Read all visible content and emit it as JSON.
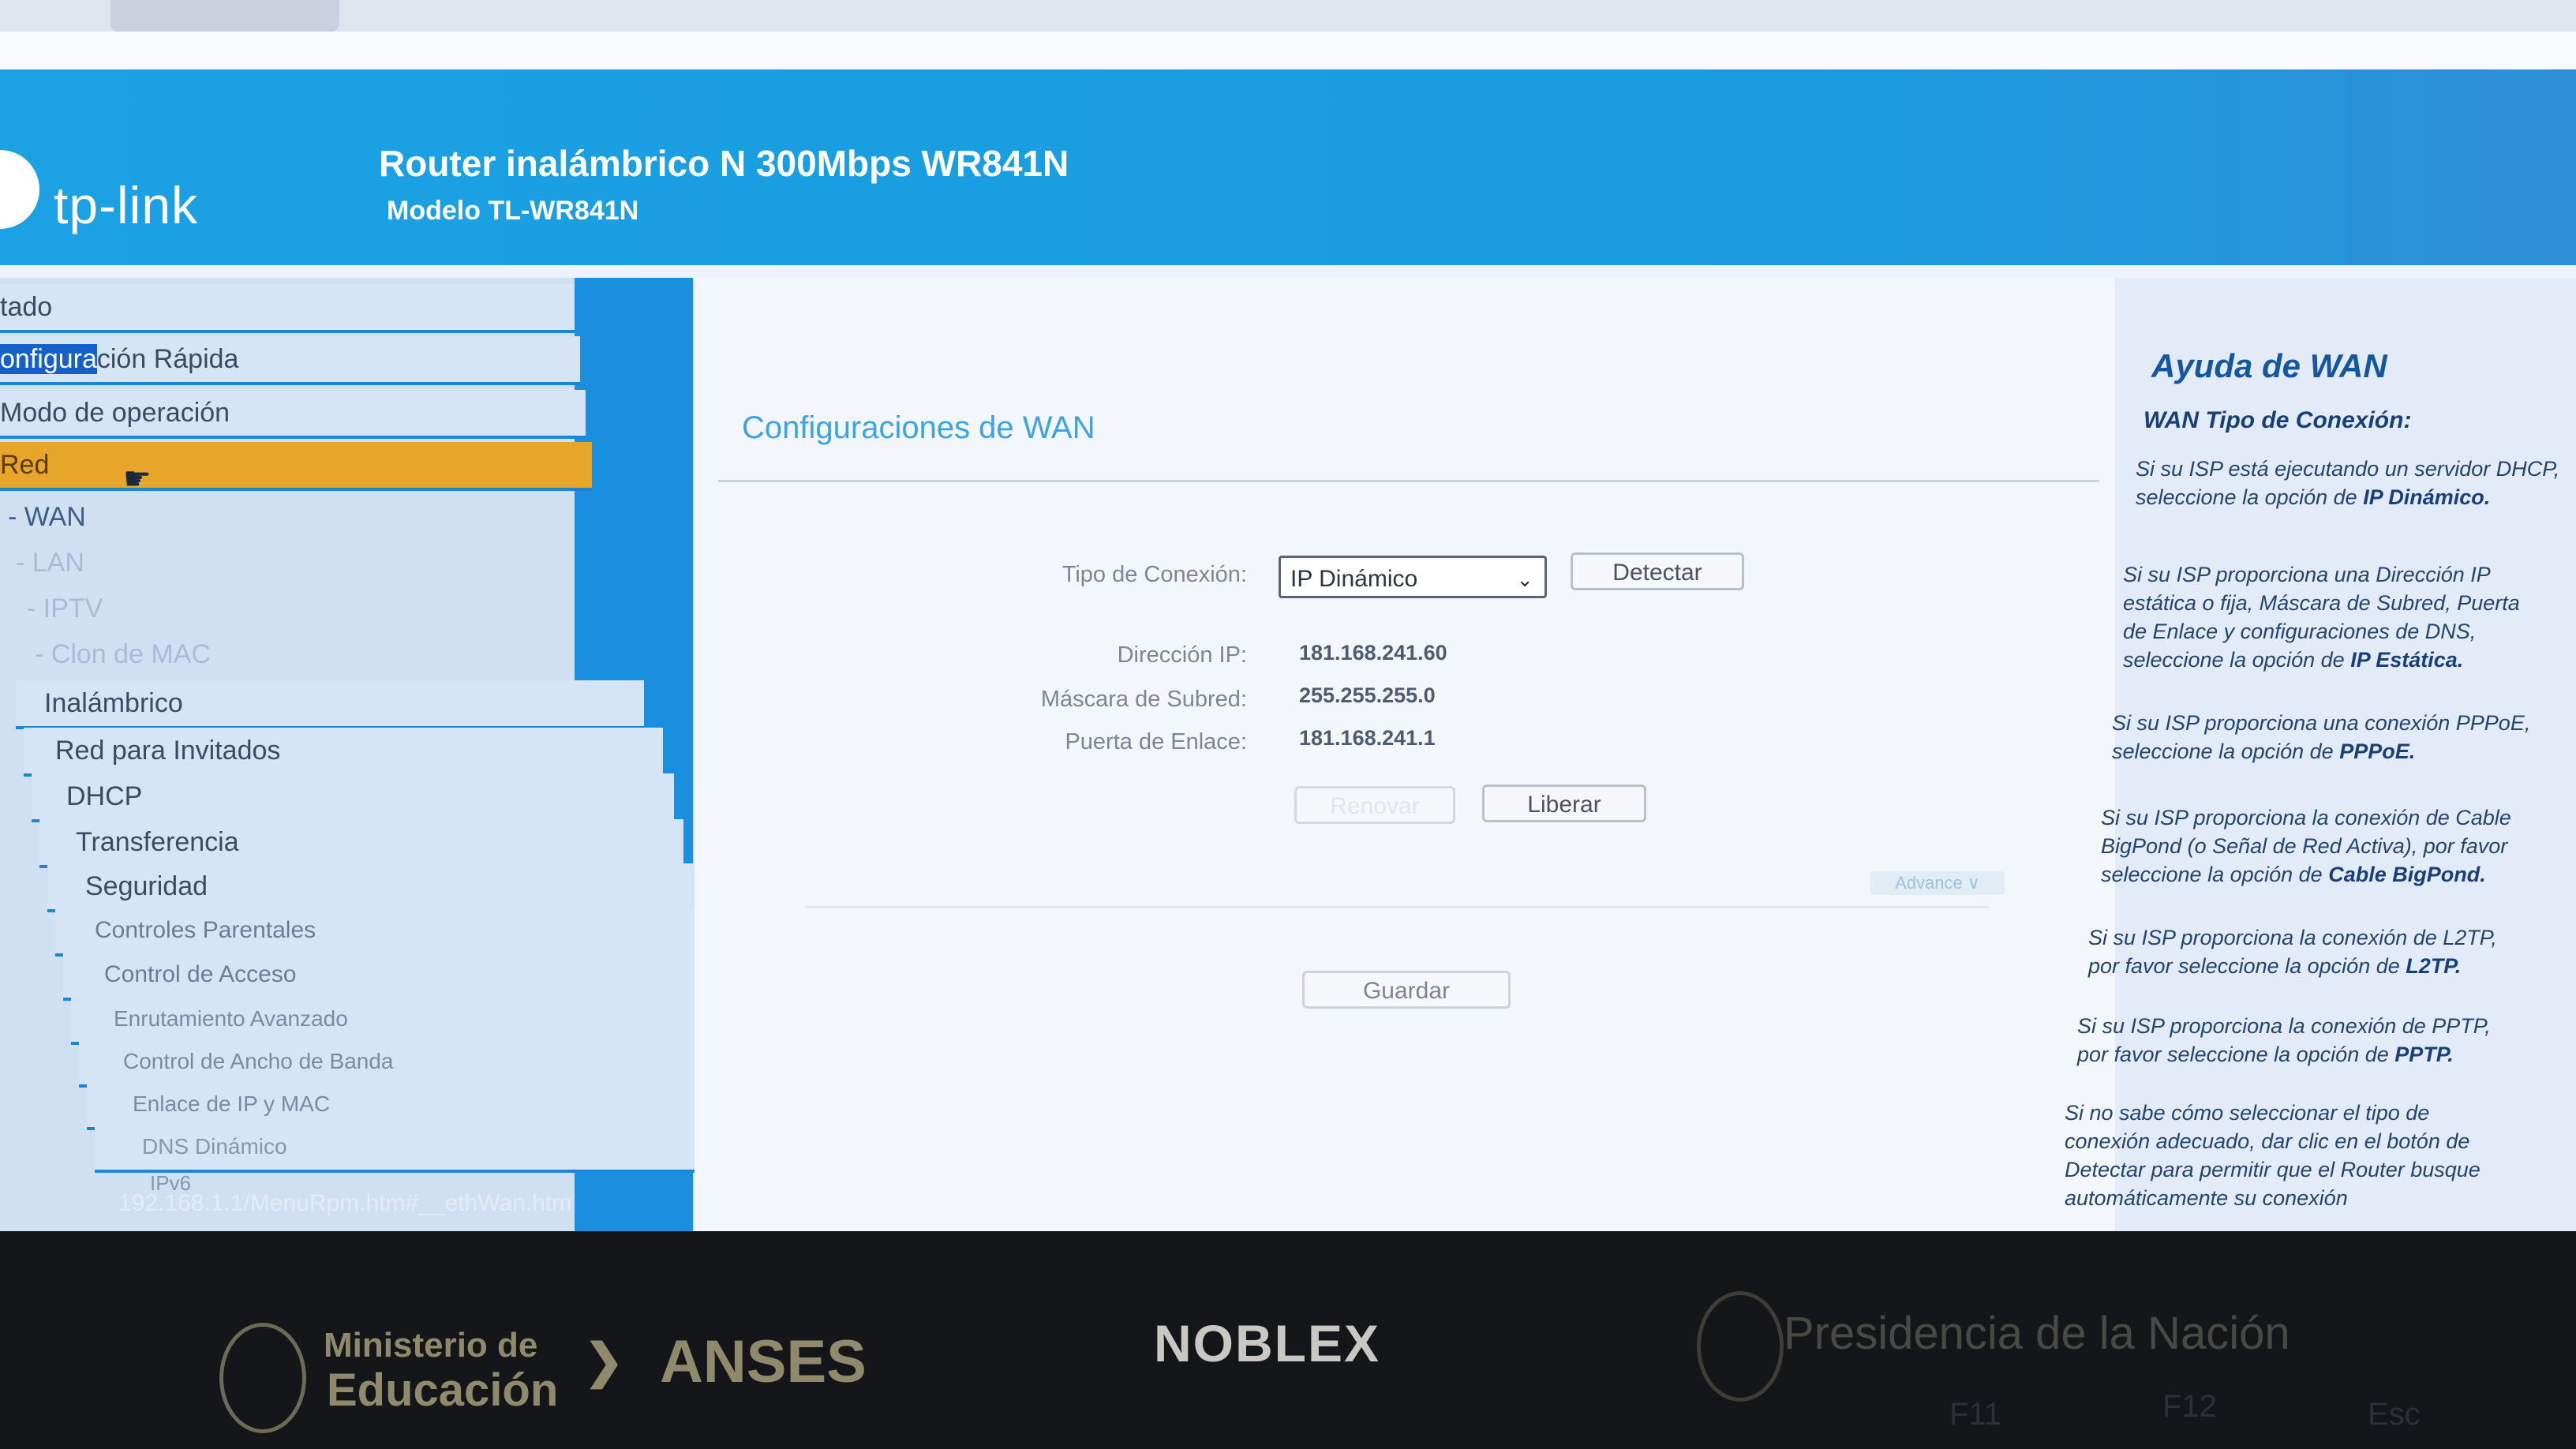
{
  "header": {
    "logo": "tp-link",
    "title": "Router inalámbrico N 300Mbps WR841N",
    "model": "Modelo TL-WR841N"
  },
  "sidebar": {
    "items": [
      {
        "label": "tado"
      },
      {
        "label_highlight": "onfigura",
        "label_rest": "ción Rápida"
      },
      {
        "label": "Modo de operación"
      },
      {
        "label": "Red"
      },
      {
        "label": "- WAN"
      },
      {
        "label": "- LAN"
      },
      {
        "label": "- IPTV"
      },
      {
        "label": "- Clon de MAC"
      },
      {
        "label": "Inalámbrico"
      },
      {
        "label": "Red para Invitados"
      },
      {
        "label": "DHCP"
      },
      {
        "label": "Transferencia"
      },
      {
        "label": "Seguridad"
      },
      {
        "label": "Controles Parentales"
      },
      {
        "label": "Control de Acceso"
      },
      {
        "label": "Enrutamiento Avanzado"
      },
      {
        "label": "Control de Ancho de Banda"
      },
      {
        "label": "Enlace de IP y MAC"
      },
      {
        "label": "DNS Dinámico"
      },
      {
        "label": "IPv6"
      }
    ]
  },
  "status_url": "192.168.1.1/MenuRpm.htm#__ethWan.htm",
  "main": {
    "section_title": "Configuraciones de WAN",
    "connection_type_label": "Tipo de Conexión:",
    "connection_type_value": "IP Dinámico",
    "detect_button": "Detectar",
    "ip_label": "Dirección IP:",
    "ip_value": "181.168.241.60",
    "mask_label": "Máscara de Subred:",
    "mask_value": "255.255.255.0",
    "gateway_label": "Puerta de Enlace:",
    "gateway_value": "181.168.241.1",
    "renew_button": "Renovar",
    "release_button": "Liberar",
    "advance_button": "Advance ∨",
    "save_button": "Guardar"
  },
  "help": {
    "title": "Ayuda de WAN",
    "subtitle": "WAN Tipo de Conexión:",
    "p1": "Si su ISP está ejecutando un servidor DHCP, seleccione la opción de",
    "p1_bold": "IP Dinámico.",
    "p2": "Si su ISP proporciona una Dirección IP estática o fija, Máscara de Subred, Puerta de Enlace y configuraciones de DNS, seleccione la opción de",
    "p2_bold": "IP Estática.",
    "p3": "Si su ISP proporciona una conexión PPPoE, seleccione la opción de",
    "p3_bold": "PPPoE.",
    "p4": "Si su ISP proporciona la conexión de Cable BigPond (o Señal de Red Activa), por favor seleccione la opción de",
    "p4_bold": "Cable BigPond.",
    "p5": "Si su ISP proporciona la conexión de L2TP, por favor seleccione la opción de",
    "p5_bold": "L2TP.",
    "p6": "Si su ISP proporciona la conexión de PPTP, por favor seleccione la opción de",
    "p6_bold": "PPTP.",
    "p7": "Si no sabe cómo seleccionar el tipo de conexión adecuado, dar clic en el botón de Detectar para permitir que el Router busque automáticamente su conexión"
  },
  "bezel": {
    "ministry_line1": "Ministerio de",
    "ministry_line2": "Educación",
    "anses": "ANSES",
    "noblex": "NOBLEX",
    "presidencia": "Presidencia de la Nación",
    "key_f11": "F11",
    "key_f12": "F12",
    "key_esc": "Esc"
  }
}
